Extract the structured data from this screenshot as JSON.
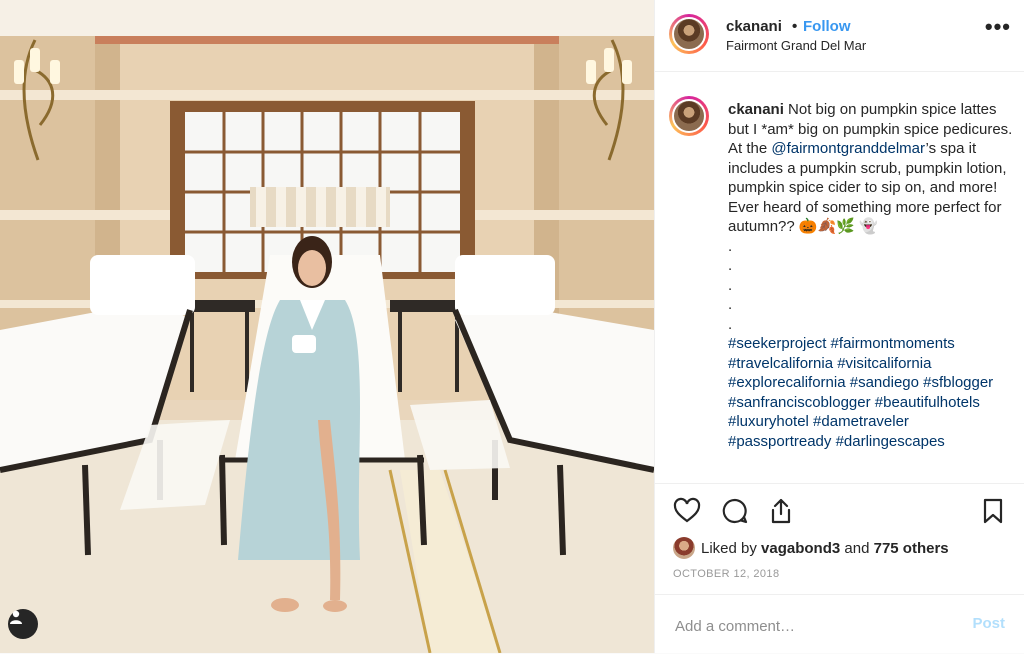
{
  "post": {
    "photo": {
      "alt_icon": "user-tag-icon"
    },
    "header": {
      "username": "ckanani",
      "separator": "•",
      "follow_label": "Follow",
      "location": "Fairmont Grand Del Mar",
      "more_icon": "more-options-icon",
      "more_label": "•••"
    },
    "caption": {
      "username": "ckanani",
      "text_1": "Not big on pumpkin spice lattes but I *am* big on pumpkin spice pedicures. At the ",
      "mention": "@fairmontgranddelmar",
      "text_2": "’s spa it includes a pumpkin scrub, pumpkin lotion, pumpkin spice cider to sip on, and more! Ever heard of something more perfect for autumn?? 🎃🍂🌿 👻",
      "dots": [
        ".",
        ".",
        ".",
        ".",
        "."
      ],
      "hashtags": "#seekerproject #fairmontmoments #travelcalifornia #visitcalifornia #explorecalifornia #sandiego #sfblogger #sanfranciscoblogger #beautifulhotels #luxuryhotel #dametraveler #passportready #darlingescapes"
    },
    "actions": {
      "icons": [
        "heart-icon",
        "comment-icon",
        "share-icon",
        "bookmark-icon"
      ]
    },
    "likes": {
      "prefix": "Liked by",
      "first_user": "vagabond3",
      "connector": "and",
      "others": "775 others"
    },
    "date": "OCTOBER 12, 2018",
    "comment_box": {
      "placeholder": "Add a comment…",
      "post_label": "Post"
    },
    "colors": {
      "link_blue": "#3897f0",
      "hashtag_navy": "#003569",
      "post_disabled": "#b2dffc",
      "muted": "#999999"
    }
  }
}
